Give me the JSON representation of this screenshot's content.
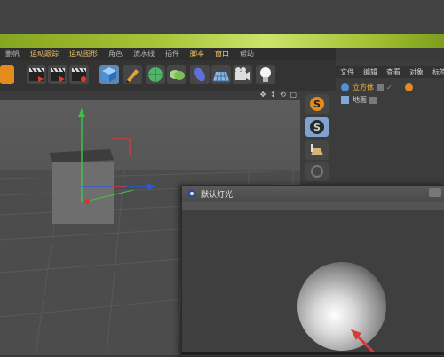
{
  "menu": {
    "items": [
      "删帆",
      "运动跟踪",
      "运动图形",
      "角色",
      "流水线",
      "插件",
      "脚本",
      "窗口",
      "帮助"
    ]
  },
  "object_manager": {
    "menu": [
      "文件",
      "编辑",
      "查看",
      "对象",
      "标签"
    ],
    "objects": [
      {
        "name": "立方体",
        "icon": "cube-object-icon"
      },
      {
        "name": "地面",
        "icon": "floor-object-icon"
      }
    ]
  },
  "viewport": {
    "tools_glyphs": "✥ ↕ ⟲ ▢"
  },
  "light_window": {
    "title": "默认灯光"
  },
  "colors": {
    "accent_orange": "#e38b1c",
    "menu_text": "#f0c470",
    "green_band": "#a6c437",
    "highlight_arrow": "#d83a3a"
  },
  "icons": [
    "s-tag-icon",
    "light-bulb-icon",
    "camera-icon",
    "sphere-icon",
    "cube-icon",
    "film-icon"
  ]
}
